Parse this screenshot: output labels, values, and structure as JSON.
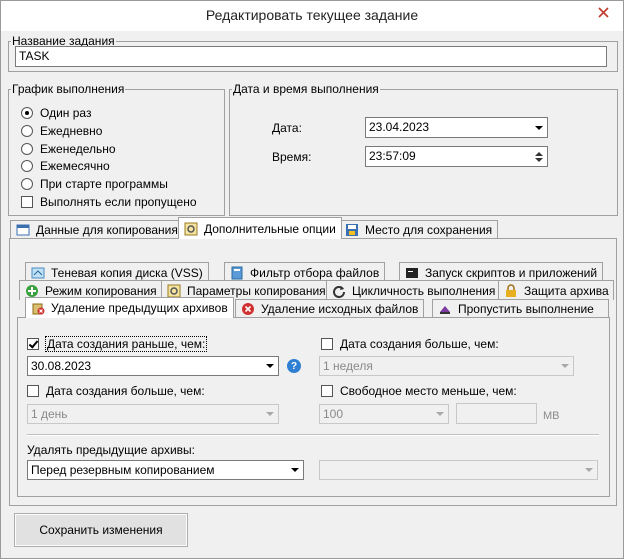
{
  "window": {
    "title": "Редактировать текущее задание"
  },
  "task_name": {
    "legend": "Название задания",
    "value": "TASK"
  },
  "schedule": {
    "legend": "График выполнения",
    "options": [
      "Один раз",
      "Ежедневно",
      "Еженедельно",
      "Ежемесячно",
      "При старте программы"
    ],
    "selected_index": 0,
    "run_if_missed_label": "Выполнять если пропущено"
  },
  "datetime": {
    "legend": "Дата и время выполнения",
    "date_label": "Дата:",
    "date_value": "23.04.2023",
    "time_label": "Время:",
    "time_value": "23:57:09"
  },
  "main_tabs": [
    {
      "label": "Данные для копирования",
      "icon": "data-icon"
    },
    {
      "label": "Дополнительные опции",
      "icon": "options-icon",
      "active": true
    },
    {
      "label": "Место для сохранения",
      "icon": "save-location-icon"
    }
  ],
  "sub_tabs": {
    "row1": [
      {
        "label": "Теневая копия диска (VSS)",
        "icon": "shadow-copy-icon"
      },
      {
        "label": "Фильтр отбора файлов",
        "icon": "filter-icon"
      },
      {
        "label": "Запуск скриптов и приложений",
        "icon": "script-icon"
      }
    ],
    "row2": [
      {
        "label": "Режим копирования",
        "icon": "copy-mode-icon"
      },
      {
        "label": "Параметры копирования",
        "icon": "copy-params-icon"
      },
      {
        "label": "Цикличность выполнения",
        "icon": "cycle-icon"
      },
      {
        "label": "Защита архива",
        "icon": "lock-icon"
      }
    ],
    "row3": [
      {
        "label": "Удаление предыдущих архивов",
        "icon": "delete-archives-icon",
        "active": true
      },
      {
        "label": "Удаление исходных файлов",
        "icon": "delete-source-icon"
      },
      {
        "label": "Пропустить выполнение",
        "icon": "skip-icon"
      }
    ]
  },
  "deletion": {
    "created_before": {
      "label": "Дата создания раньше, чем:",
      "checked": true,
      "value": "30.08.2023"
    },
    "created_after_right": {
      "label": "Дата создания больше, чем:",
      "checked": false,
      "value": "1 неделя"
    },
    "created_after_left": {
      "label": "Дата создания больше, чем:",
      "checked": false,
      "value": "1 день"
    },
    "free_space": {
      "label": "Свободное место меньше, чем:",
      "checked": false,
      "value": "100",
      "unit": "MB"
    },
    "delete_when_label": "Удалять предыдущие архивы:",
    "delete_when_value": "Перед резервным копированием",
    "second_combo_value": ""
  },
  "save_button": {
    "label": "Сохранить изменения"
  }
}
